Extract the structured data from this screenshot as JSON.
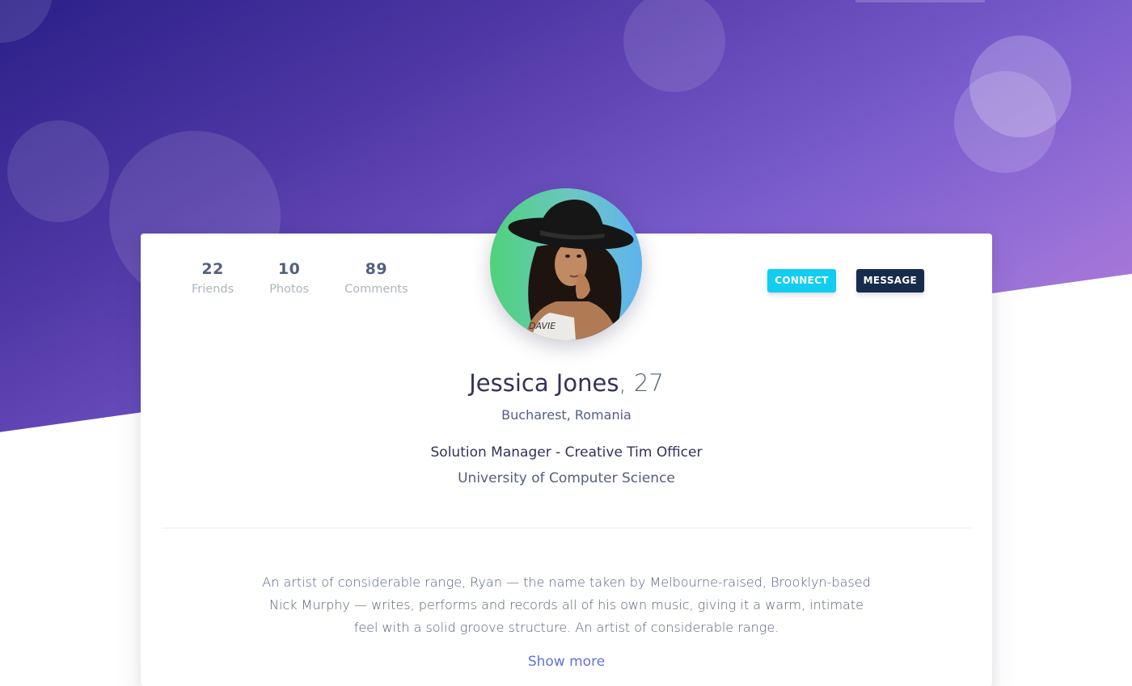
{
  "profile": {
    "name": "Jessica Jones",
    "age_text": ", 27",
    "location": "Bucharest, Romania",
    "job": "Solution Manager - Creative Tim Officer",
    "school": "University of Computer Science",
    "bio": "An artist of considerable range, Ryan — the name taken by Melbourne-raised, Brooklyn-based Nick Murphy — writes, performs and records all of his own music, giving it a warm, intimate feel with a solid groove structure. An artist of considerable range.",
    "show_more": "Show more"
  },
  "stats": [
    {
      "value": "22",
      "label": "Friends"
    },
    {
      "value": "10",
      "label": "Photos"
    },
    {
      "value": "89",
      "label": "Comments"
    }
  ],
  "actions": {
    "connect_label": "CONNECT",
    "message_label": "MESSAGE"
  },
  "avatar": {
    "shirt_text": "DAVIE"
  },
  "colors": {
    "accent": "#5e72e4",
    "connect": "#11cdef",
    "message": "#172b4d",
    "heading": "#32325d",
    "muted": "#adb5bd"
  }
}
